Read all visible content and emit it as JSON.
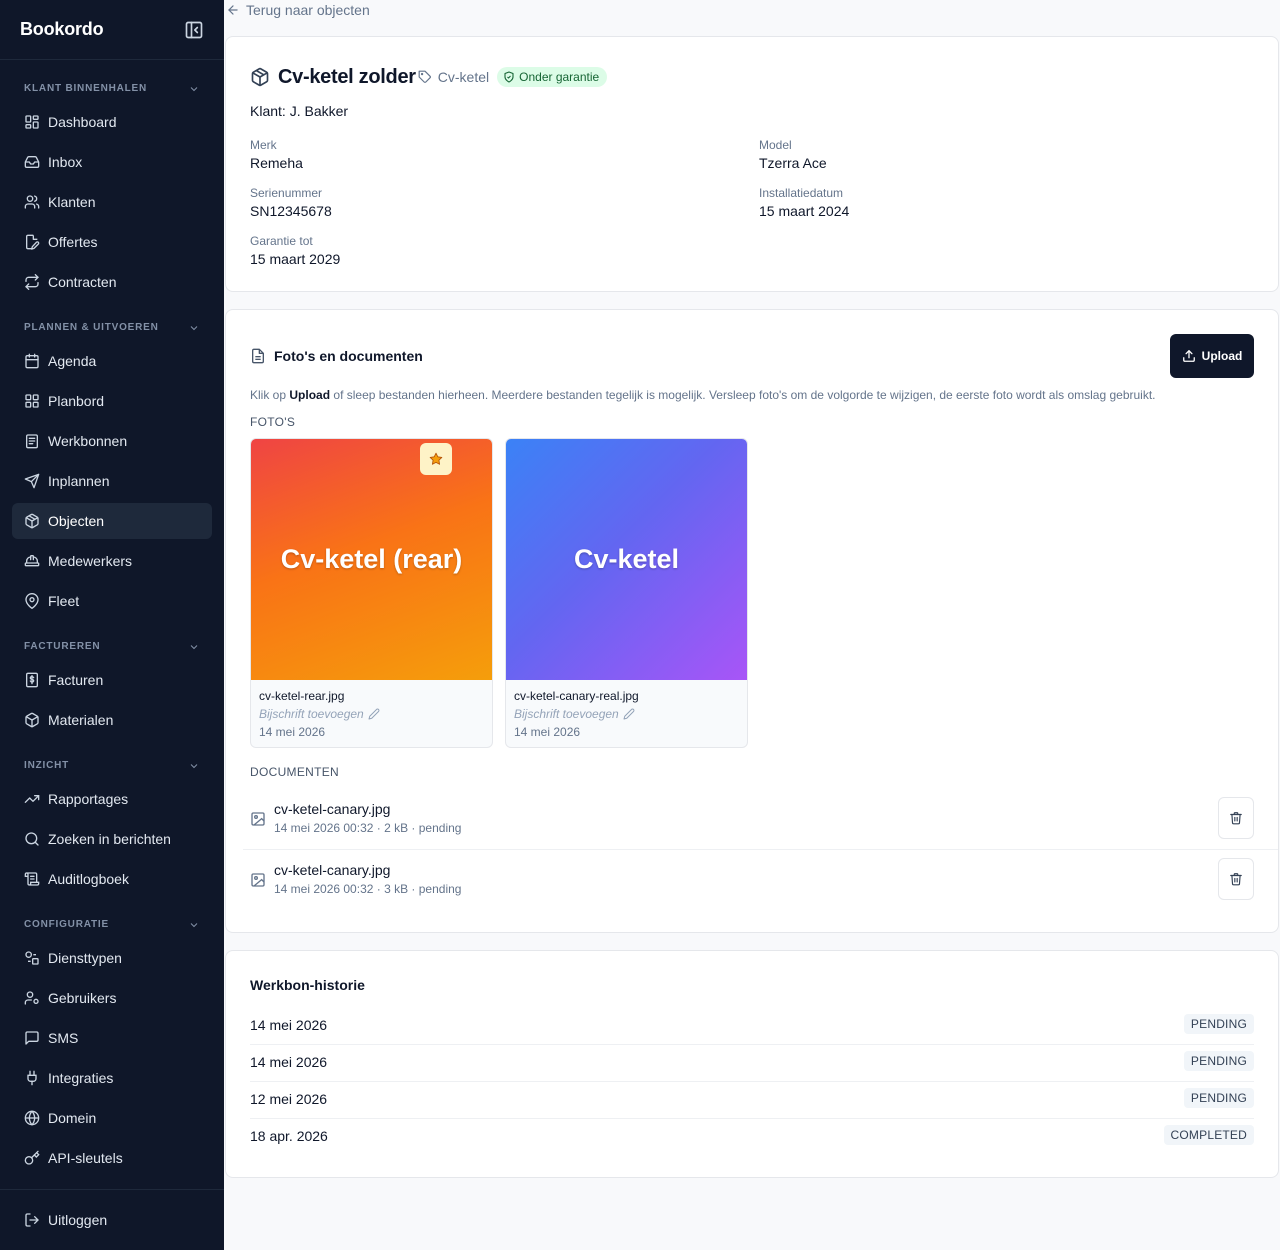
{
  "app": {
    "name": "Bookordo"
  },
  "sidebar": {
    "sections": [
      {
        "label": "KLANT BINNENHALEN"
      },
      {
        "label": "PLANNEN & UITVOEREN"
      },
      {
        "label": "FACTUREREN"
      },
      {
        "label": "INZICHT"
      },
      {
        "label": "CONFIGURATIE"
      }
    ],
    "items": [
      {
        "label": "Dashboard",
        "icon": "dashboard-icon"
      },
      {
        "label": "Inbox",
        "icon": "inbox-icon"
      },
      {
        "label": "Klanten",
        "icon": "users-icon"
      },
      {
        "label": "Offertes",
        "icon": "file-edit-icon"
      },
      {
        "label": "Contracten",
        "icon": "repeat-icon"
      },
      {
        "label": "Agenda",
        "icon": "calendar-icon"
      },
      {
        "label": "Planbord",
        "icon": "board-icon"
      },
      {
        "label": "Werkbonnen",
        "icon": "clipboard-icon"
      },
      {
        "label": "Inplannen",
        "icon": "send-icon"
      },
      {
        "label": "Objecten",
        "icon": "package-icon",
        "active": true
      },
      {
        "label": "Medewerkers",
        "icon": "hardhat-icon"
      },
      {
        "label": "Fleet",
        "icon": "map-pin-icon"
      },
      {
        "label": "Facturen",
        "icon": "invoice-icon"
      },
      {
        "label": "Materialen",
        "icon": "box-icon"
      },
      {
        "label": "Rapportages",
        "icon": "trending-icon"
      },
      {
        "label": "Zoeken in berichten",
        "icon": "search-icon"
      },
      {
        "label": "Auditlogboek",
        "icon": "scroll-icon"
      },
      {
        "label": "Diensttypen",
        "icon": "shapes-icon"
      },
      {
        "label": "Gebruikers",
        "icon": "user-cog-icon"
      },
      {
        "label": "SMS",
        "icon": "message-icon"
      },
      {
        "label": "Integraties",
        "icon": "plug-icon"
      },
      {
        "label": "Domein",
        "icon": "globe-icon"
      },
      {
        "label": "API-sleutels",
        "icon": "key-icon"
      }
    ],
    "logout": "Uitloggen"
  },
  "back_link": "Terug naar objecten",
  "object": {
    "title": "Cv-ketel zolder",
    "type": "Cv-ketel",
    "warranty_badge": "Onder garantie",
    "klant_label": "Klant:",
    "klant_name": "J. Bakker",
    "fields": [
      {
        "label": "Merk",
        "value": "Remeha"
      },
      {
        "label": "Model",
        "value": "Tzerra Ace"
      },
      {
        "label": "Serienummer",
        "value": "SN12345678"
      },
      {
        "label": "Installatiedatum",
        "value": "15 maart 2024"
      },
      {
        "label": "Garantie tot",
        "value": "15 maart 2029"
      }
    ]
  },
  "media": {
    "title": "Foto's en documenten",
    "upload_label": "Upload",
    "help_prefix": "Klik op",
    "help_bold": "Upload",
    "help_suffix": "of sleep bestanden hierheen. Meerdere bestanden tegelijk is mogelijk. Versleep foto's om de volgorde te wijzigen, de eerste foto wordt als omslag gebruikt.",
    "photos_label": "FOTO'S",
    "photos": [
      {
        "image_text": "Cv-ketel (rear)",
        "filename": "cv-ketel-rear.jpg",
        "caption_placeholder": "Bijschrift toevoegen",
        "date": "14 mei 2026",
        "cover": true
      },
      {
        "image_text": "Cv-ketel",
        "filename": "cv-ketel-canary-real.jpg",
        "caption_placeholder": "Bijschrift toevoegen",
        "date": "14 mei 2026",
        "cover": false
      }
    ],
    "documents_label": "DOCUMENTEN",
    "documents": [
      {
        "name": "cv-ketel-canary.jpg",
        "meta": "14 mei 2026 00:32 · 2 kB · pending"
      },
      {
        "name": "cv-ketel-canary.jpg",
        "meta": "14 mei 2026 00:32 · 3 kB · pending"
      }
    ]
  },
  "history": {
    "title": "Werkbon-historie",
    "rows": [
      {
        "date": "14 mei 2026",
        "status": "PENDING"
      },
      {
        "date": "14 mei 2026",
        "status": "PENDING"
      },
      {
        "date": "12 mei 2026",
        "status": "PENDING"
      },
      {
        "date": "18 apr. 2026",
        "status": "COMPLETED"
      }
    ]
  },
  "colors": {
    "sidebar_bg": "#0f1729",
    "active_item": "#1e293b",
    "success_bg": "#dcfce7",
    "success_text": "#166534",
    "primary_btn": "#0f172a"
  }
}
